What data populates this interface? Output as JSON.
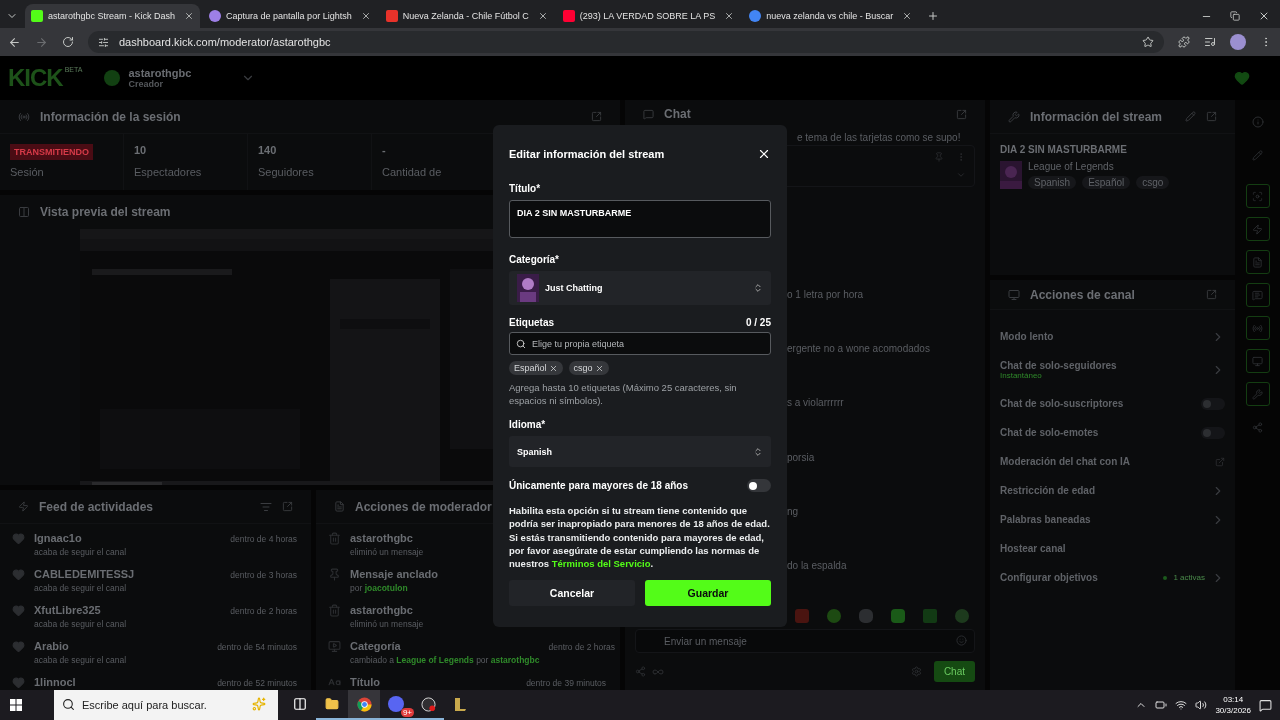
{
  "browser": {
    "tabs": [
      {
        "title": "astarothgbc Stream - Kick Dash",
        "kind": "kick",
        "selected": true
      },
      {
        "title": "Captura de pantalla por Lightsh",
        "kind": "feather",
        "selected": false
      },
      {
        "title": "Nueva Zelanda - Chile Fútbol C",
        "kind": "sport",
        "selected": false
      },
      {
        "title": "(293) LA VERDAD SOBRE LA PS",
        "kind": "video",
        "selected": false
      },
      {
        "title": "nueva zelanda vs chile - Buscar",
        "kind": "search",
        "selected": false
      }
    ],
    "address": "dashboard.kick.com/moderator/astarothgbc"
  },
  "header": {
    "logo": "KICK",
    "logo_badge": "BETA",
    "username": "astarothgbc",
    "role": "Creador"
  },
  "session": {
    "title": "Información de la sesión",
    "status": "TRANSMITIENDO",
    "status_label": "Sesión",
    "stats": [
      {
        "value": "10",
        "label": "Espectadores"
      },
      {
        "value": "140",
        "label": "Seguidores"
      },
      {
        "value": "-",
        "label": "Cantidad de"
      }
    ]
  },
  "preview": {
    "title": "Vista previa del stream"
  },
  "feed": {
    "title": "Feed de actividades",
    "items": [
      {
        "name": "Ignaac1o",
        "action": "acaba de seguir el canal",
        "time": "dentro de 4 horas"
      },
      {
        "name": "CABLEDEMITESSJ",
        "action": "acaba de seguir el canal",
        "time": "dentro de 3 horas"
      },
      {
        "name": "XfutLibre325",
        "action": "acaba de seguir el canal",
        "time": "dentro de 2 horas"
      },
      {
        "name": "Arabio",
        "action": "acaba de seguir el canal",
        "time": "dentro de 54 minutos"
      },
      {
        "name": "1linnocl",
        "time": "dentro de 52 minutos"
      }
    ]
  },
  "mod_actions": {
    "title": "Acciones de moderador",
    "items": [
      {
        "kind": "delete",
        "title": "astarothgbc",
        "detail": "eliminó un mensaje"
      },
      {
        "kind": "pin",
        "title": "Mensaje anclado",
        "detail": "por **joacotulon**"
      },
      {
        "kind": "delete",
        "title": "astarothgbc",
        "detail": "eliminó un mensaje"
      },
      {
        "kind": "category",
        "title": "Categoría",
        "detail": "cambiado a **League of Legends** por **astarothgbc**",
        "time": "dentro de 2 horas"
      },
      {
        "kind": "title",
        "title": "Título",
        "time": "dentro de 39 minutos"
      }
    ]
  },
  "chat": {
    "title": "Chat",
    "top_message": "e tema de las tarjetas como se supo!",
    "messages": [
      "o 1 letra por hora",
      "ergente no a wone acomodados",
      "s a violarrrrrr",
      "porsia",
      "ng",
      "do la espalda"
    ],
    "placeholder": "Enviar un mensaje",
    "send": "Chat"
  },
  "stream_info": {
    "title": "Información del stream",
    "stream_title": "DIA 2 SIN MASTURBARME",
    "category": "League of Legends",
    "tags": [
      "Spanish",
      "Español",
      "csgo"
    ]
  },
  "channel_actions": {
    "title": "Acciones de canal",
    "items": [
      {
        "kind": "link",
        "label": "Modo lento"
      },
      {
        "kind": "link",
        "label": "Chat de solo-seguidores",
        "sub": "Instantáneo"
      },
      {
        "kind": "toggle",
        "label": "Chat de solo-suscriptores",
        "on": false
      },
      {
        "kind": "toggle",
        "label": "Chat de solo-emotes",
        "on": false
      },
      {
        "kind": "external",
        "label": "Moderación del chat con IA"
      },
      {
        "kind": "link",
        "label": "Restricción de edad"
      },
      {
        "kind": "link",
        "label": "Palabras baneadas"
      },
      {
        "kind": "plain",
        "label": "Hostear canal"
      },
      {
        "kind": "link",
        "label": "Configurar objetivos",
        "badge": "1 activas"
      }
    ]
  },
  "modal": {
    "title": "Editar información del stream",
    "title_label": "Título*",
    "title_value": "DIA 2 SIN MASTURBARME",
    "category_label": "Categoría*",
    "category": "Just Chatting",
    "tags_label": "Etiquetas",
    "tags_count": "0 / 25",
    "tags_placeholder": "Elige tu propia etiqueta",
    "tags": [
      "Español",
      "csgo"
    ],
    "tags_help": "Agrega hasta 10 etiquetas (Máximo 25 caracteres, sin espacios ni símbolos).",
    "language_label": "Idioma*",
    "language": "Spanish",
    "mature_label": "Únicamente para mayores de 18 años",
    "mature_on": false,
    "mature_help": "Habilita esta opción si tu stream tiene contenido que podría ser inapropiado para menores de 18 años de edad. Si estás transmitiendo contenido para mayores de edad, por favor asegúrate de estar cumpliendo las normas de nuestros",
    "mature_link": "Términos del Servicio",
    "mature_help_end": ".",
    "cancel": "Cancelar",
    "save": "Guardar"
  },
  "taskbar": {
    "search_placeholder": "Escribe aquí para buscar.",
    "badge": "9+",
    "time": "03:14",
    "date": "30/3/2026"
  }
}
